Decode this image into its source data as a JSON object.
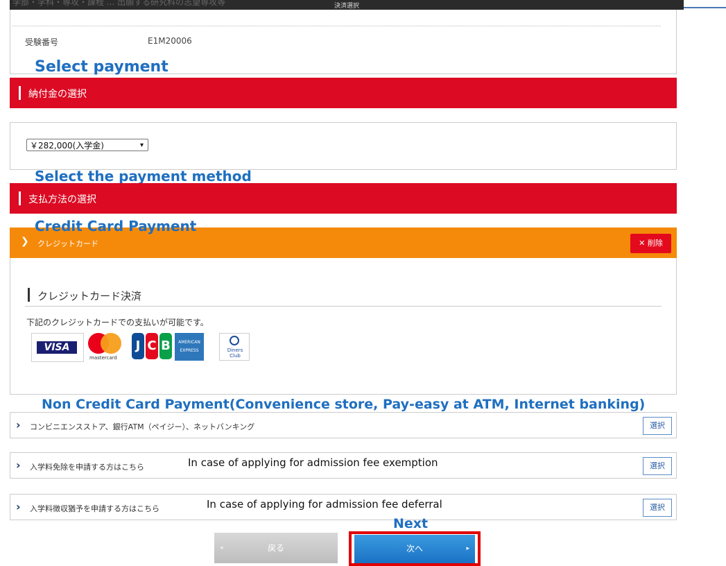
{
  "header": {
    "title": "決済選択"
  },
  "exam": {
    "label": "受験番号",
    "value": "E1M20006",
    "cut_row_text": "学部・学科・専攻・課程 ... 出願する研究科の志望専攻等"
  },
  "annotations": {
    "select_payment": "Select payment",
    "select_method": "Select the payment method",
    "credit_card": "Credit Card Payment",
    "non_credit": "Non Credit Card Payment(Convenience store, Pay-easy at ATM, Internet banking)",
    "exemption": "In case of applying for admission fee exemption",
    "deferral": "In case of applying for admission fee deferral",
    "next": "Next"
  },
  "payment_section": {
    "title": "納付金の選択",
    "selected": "￥282,000(入学金)"
  },
  "method_section": {
    "title": "支払方法の選択"
  },
  "credit_card": {
    "accordion_label": "クレジットカード",
    "delete_label": "✕ 削除",
    "heading": "クレジットカード決済",
    "description": "下記のクレジットカードでの支払いが可能です。",
    "brands": {
      "visa": "VISA",
      "mastercard": "mastercard",
      "jcb": [
        "J",
        "C",
        "B"
      ],
      "amex": "AMERICAN EXPRESS",
      "diners": "Diners Club"
    }
  },
  "options": [
    {
      "label": "コンビニエンスストア、銀行ATM（ペイジー）、ネットバンキング",
      "button": "選択"
    },
    {
      "label": "入学料免除を申請する方はこちら",
      "button": "選択"
    },
    {
      "label": "入学料徴収猶予を申請する方はこちら",
      "button": "選択"
    }
  ],
  "nav": {
    "back": "戻る",
    "next": "次へ"
  },
  "colors": {
    "section_red": "#dc0a23",
    "accordion_orange": "#f58a0a",
    "annotation_blue": "#1f6fc0",
    "next_blue": "#1a72c4"
  }
}
